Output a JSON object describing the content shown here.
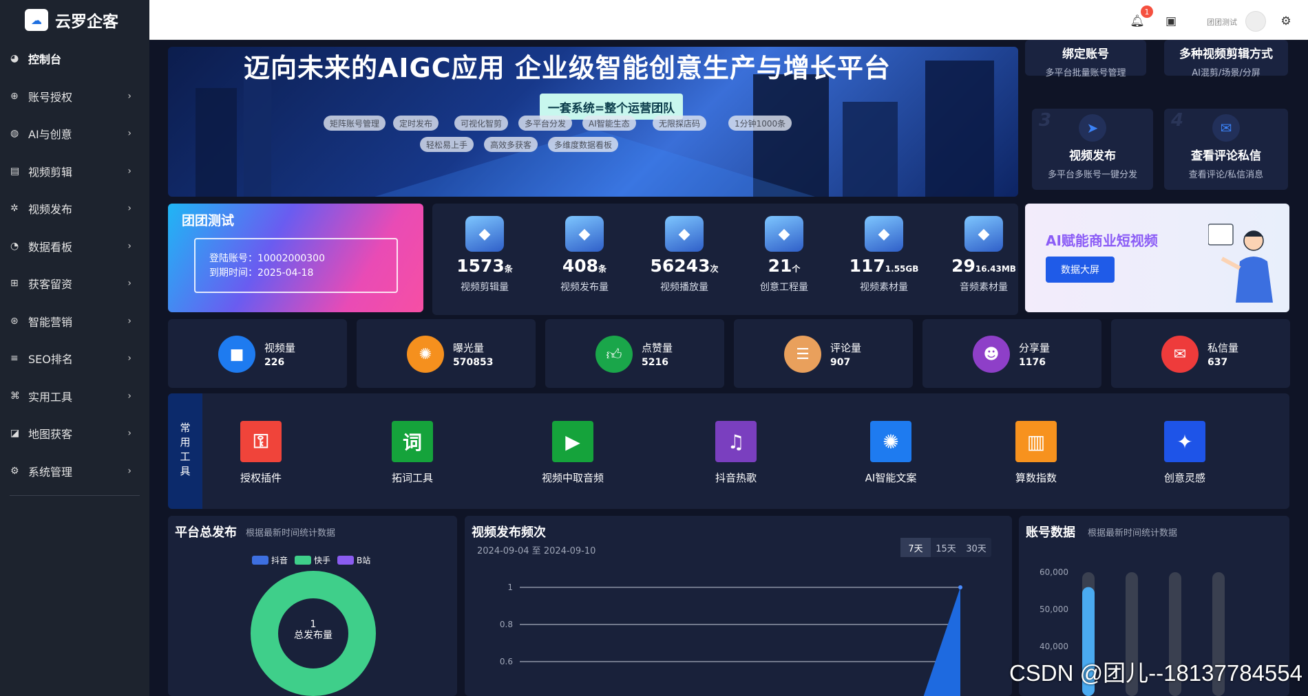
{
  "app": {
    "logo_icon": "cloud-logo-icon",
    "title": "云罗企客"
  },
  "sidebar": {
    "items": [
      {
        "label": "控制台",
        "icon": "dashboard-icon",
        "glyph": "◕",
        "active": true,
        "arrow": ""
      },
      {
        "label": "账号授权",
        "icon": "target-icon",
        "glyph": "⊕",
        "arrow": "›"
      },
      {
        "label": "AI与创意",
        "icon": "globe-icon",
        "glyph": "◍",
        "arrow": "›"
      },
      {
        "label": "视频剪辑",
        "icon": "film-icon",
        "glyph": "▤",
        "arrow": "›"
      },
      {
        "label": "视频发布",
        "icon": "gear-icon",
        "glyph": "✲",
        "arrow": "›"
      },
      {
        "label": "数据看板",
        "icon": "pie-chart-icon",
        "glyph": "◔",
        "arrow": "›"
      },
      {
        "label": "获客留资",
        "icon": "org-chart-icon",
        "glyph": "⊞",
        "arrow": "›"
      },
      {
        "label": "智能营销",
        "icon": "palette-icon",
        "glyph": "⊛",
        "arrow": "›"
      },
      {
        "label": "SEO排名",
        "icon": "sort-icon",
        "glyph": "≡",
        "arrow": "›"
      },
      {
        "label": "实用工具",
        "icon": "command-icon",
        "glyph": "⌘",
        "arrow": "›"
      },
      {
        "label": "地图获客",
        "icon": "map-icon",
        "glyph": "◪",
        "arrow": "›"
      },
      {
        "label": "系统管理",
        "icon": "settings-icon",
        "glyph": "⚙",
        "arrow": "›"
      }
    ]
  },
  "topbar": {
    "notif_count": "1",
    "user_name": "团团测试",
    "bell_icon": "bell-icon",
    "calendar_icon": "calendar-icon",
    "settings_icon": "settings-icon"
  },
  "banner": {
    "title": "迈向未来的AIGC应用  企业级智能创意生产与增长平台",
    "subtitle": "一套系统=整个运营团队",
    "chips_row1": [
      "矩阵账号管理",
      "定时发布",
      "可视化智剪",
      "多平台分发",
      "AI智能生态",
      "无限探店码",
      "1分钟1000条"
    ],
    "chips_row2": [
      "轻松易上手",
      "高效多获客",
      "多维度数据看板"
    ]
  },
  "features": [
    {
      "title": "绑定账号",
      "sub": "多平台批量账号管理"
    },
    {
      "title": "多种视频剪辑方式",
      "sub": "AI混剪/场景/分屏"
    },
    {
      "title": "视频发布",
      "sub": "多平台多账号一键分发",
      "num": "3",
      "icon": "send-icon"
    },
    {
      "title": "查看评论私信",
      "sub": "查看评论/私信消息",
      "num": "4",
      "icon": "chat-icon"
    }
  ],
  "team": {
    "title": "团团测试",
    "account": "登陆账号：10002000300",
    "expire": "到期时间：2025-04-18"
  },
  "stats": [
    {
      "value": "1573",
      "unit": "条",
      "label": "视频剪辑量"
    },
    {
      "value": "408",
      "unit": "条",
      "label": "视频发布量"
    },
    {
      "value": "56243",
      "unit": "次",
      "label": "视频播放量"
    },
    {
      "value": "21",
      "unit": "个",
      "label": "创意工程量"
    },
    {
      "value": "117",
      "unit": "1.55GB",
      "label": "视频素材量"
    },
    {
      "value": "29",
      "unit": "16.43MB",
      "label": "音频素材量"
    }
  ],
  "ai_card": {
    "title": "AI赋能商业短视频",
    "button": "数据大屏"
  },
  "metrics": [
    {
      "label": "视频量",
      "value": "226",
      "icon": "video-camera-icon",
      "color": "#1e7bf0"
    },
    {
      "label": "曝光量",
      "value": "570853",
      "icon": "aperture-icon",
      "color": "#f5901e"
    },
    {
      "label": "点赞量",
      "value": "5216",
      "icon": "thumbs-up-icon",
      "color": "#1aa64a"
    },
    {
      "label": "评论量",
      "value": "907",
      "icon": "comment-icon",
      "color": "#e9a05c"
    },
    {
      "label": "分享量",
      "value": "1176",
      "icon": "share-user-icon",
      "color": "#8e3fc8"
    },
    {
      "label": "私信量",
      "value": "637",
      "icon": "mail-icon",
      "color": "#ee3b3b"
    }
  ],
  "tools": {
    "tag": "常用工具",
    "items": [
      {
        "label": "授权插件",
        "icon": "shield-key-icon",
        "color": "#f0443a",
        "glyph": "⚿"
      },
      {
        "label": "拓词工具",
        "icon": "word-icon",
        "color": "#15a33b",
        "glyph": "词"
      },
      {
        "label": "视频中取音频",
        "icon": "video-icon",
        "color": "#15a33b",
        "glyph": "▶"
      },
      {
        "label": "抖音热歌",
        "icon": "music-icon",
        "color": "#7a3fbf",
        "glyph": "♫"
      },
      {
        "label": "AI智能文案",
        "icon": "ai-icon",
        "color": "#1e7bf0",
        "glyph": "✺"
      },
      {
        "label": "算数指数",
        "icon": "chart-icon",
        "color": "#f7921e",
        "glyph": "▥"
      },
      {
        "label": "创意灵感",
        "icon": "spark-icon",
        "color": "#1e54e8",
        "glyph": "✦"
      }
    ]
  },
  "platform_panel": {
    "title": "平台总发布",
    "sub": "根据最新时间统计数据",
    "legend": [
      {
        "name": "抖音",
        "color": "#3d6fe0"
      },
      {
        "name": "快手",
        "color": "#3fcf8a"
      },
      {
        "name": "B站",
        "color": "#8a5cf0"
      }
    ],
    "center_value": "1",
    "center_label": "总发布量"
  },
  "video_panel": {
    "title": "视频发布频次",
    "range": "2024-09-04 至 2024-09-10",
    "tabs": [
      "7天",
      "15天",
      "30天"
    ],
    "active_tab": 0
  },
  "account_panel": {
    "title": "账号数据",
    "sub": "根据最新时间统计数据"
  },
  "chart_data": [
    {
      "type": "line",
      "yticks": [
        "1",
        "0.8",
        "0.6"
      ],
      "ylim": [
        0.6,
        1
      ],
      "series": [
        {
          "values": [
            0,
            0,
            0,
            0,
            0,
            0,
            1
          ]
        }
      ]
    },
    {
      "type": "bar",
      "yticks": [
        "60,000",
        "50,000",
        "40,000"
      ],
      "ylim": [
        40000,
        60000
      ],
      "series": [
        {
          "values": [
            56000,
            0,
            0,
            0
          ]
        }
      ]
    }
  ],
  "watermark": "CSDN @团儿--18137784554"
}
